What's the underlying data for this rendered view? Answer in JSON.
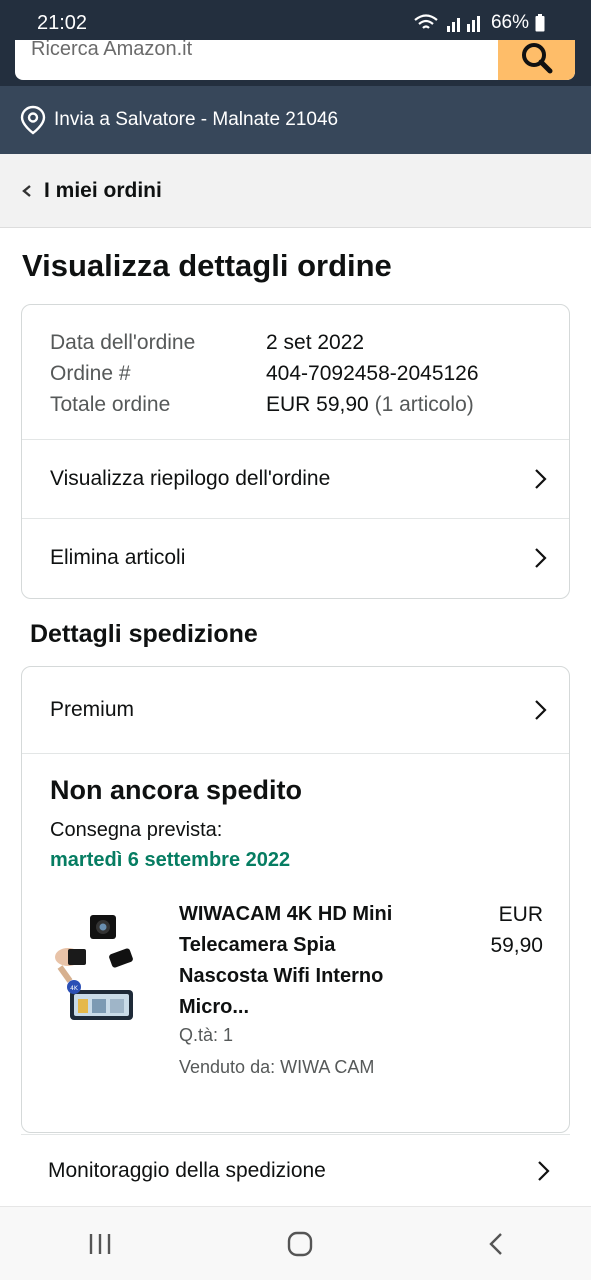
{
  "status_bar": {
    "time": "21:02",
    "battery": "66%"
  },
  "search": {
    "placeholder": "Ricerca Amazon.it"
  },
  "delivery": {
    "text": "Invia a Salvatore - Malnate 21046"
  },
  "nav": {
    "back_label": "I miei ordini"
  },
  "page": {
    "title": "Visualizza dettagli ordine"
  },
  "order": {
    "rows": [
      {
        "label": "Data dell'ordine",
        "value": "2 set 2022",
        "extra": ""
      },
      {
        "label": "Ordine #",
        "value": "404-7092458-2045126",
        "extra": ""
      },
      {
        "label": "Totale ordine",
        "value": "EUR 59,90",
        "extra": "(1 articolo)"
      }
    ],
    "summary_link": "Visualizza riepilogo dell'ordine",
    "delete_link": "Elimina articoli"
  },
  "shipping": {
    "section_title": "Dettagli spedizione",
    "method": "Premium",
    "status": "Non ancora spedito",
    "eta_label": "Consegna prevista:",
    "eta_date": "martedì 6 settembre 2022",
    "product": {
      "title": "WIWACAM 4K HD Mini Telecamera Spia Nascosta Wifi Interno Micro...",
      "price_currency": "EUR",
      "price_value": "59,90",
      "quantity": "Q.tà: 1",
      "seller": "Venduto da: WIWA CAM",
      "image": "mini-spy-camera-product-photo"
    },
    "tracking_link": "Monitoraggio della spedizione"
  },
  "colors": {
    "header_dark": "#232f3e",
    "delivery_bar": "#37475a",
    "search_button": "#febd69",
    "eta_green": "#067d62"
  },
  "icons": [
    "wifi-icon",
    "signal-icon",
    "battery-icon",
    "search-icon",
    "location-pin-icon",
    "chevron-left-icon",
    "chevron-right-icon",
    "recents-icon",
    "home-icon",
    "back-icon"
  ]
}
